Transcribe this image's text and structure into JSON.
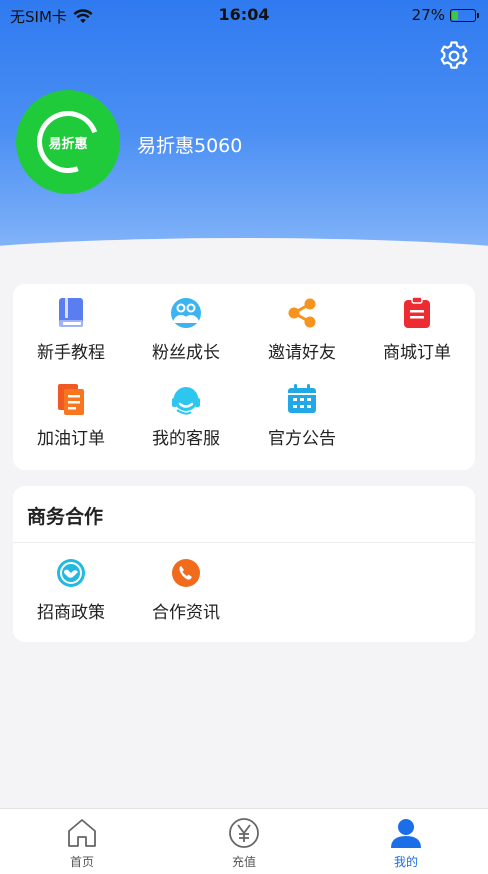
{
  "status_bar": {
    "carrier": "无SIM卡",
    "time": "16:04",
    "battery": "27%",
    "battery_level": 0.27
  },
  "profile": {
    "avatar_text": "易折惠",
    "username": "易折惠5060"
  },
  "colors": {
    "header_blue": "#2f7af0",
    "avatar_green": "#1fcb3a",
    "active_tab": "#1a6ee8"
  },
  "menu": {
    "items": [
      {
        "label": "新手教程",
        "icon": "book-icon"
      },
      {
        "label": "粉丝成长",
        "icon": "users-icon"
      },
      {
        "label": "邀请好友",
        "icon": "share-icon"
      },
      {
        "label": "商城订单",
        "icon": "clipboard-icon"
      },
      {
        "label": "加油订单",
        "icon": "document-icon"
      },
      {
        "label": "我的客服",
        "icon": "headset-icon"
      },
      {
        "label": "官方公告",
        "icon": "calendar-icon"
      }
    ]
  },
  "business": {
    "title": "商务合作",
    "items": [
      {
        "label": "招商政策",
        "icon": "handshake-icon"
      },
      {
        "label": "合作资讯",
        "icon": "phone-icon"
      }
    ]
  },
  "tabbar": {
    "items": [
      {
        "label": "首页",
        "icon": "home-icon"
      },
      {
        "label": "充值",
        "icon": "yen-icon"
      },
      {
        "label": "我的",
        "icon": "user-icon"
      }
    ]
  }
}
